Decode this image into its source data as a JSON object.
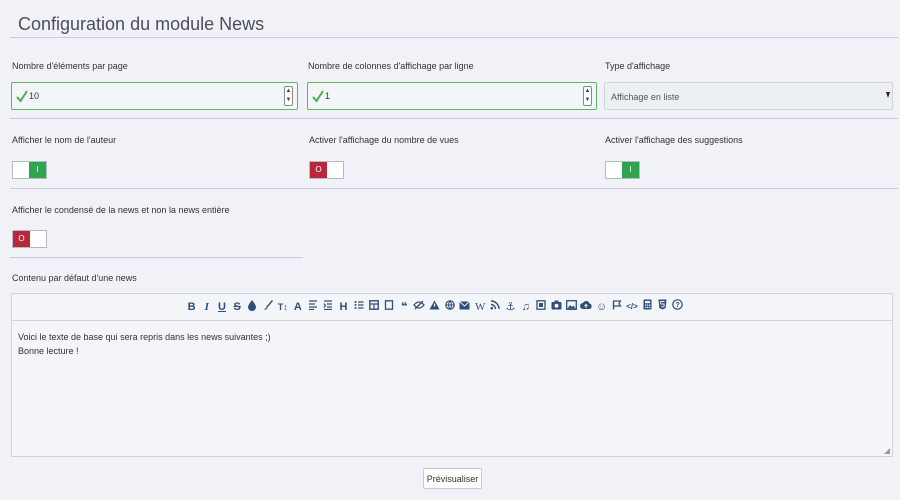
{
  "page": {
    "title": "Configuration du module News"
  },
  "items_per_page": {
    "label": "Nombre d'éléments par page",
    "value": "10"
  },
  "columns_per_row": {
    "label": "Nombre de colonnes d'affichage par ligne",
    "value": "1"
  },
  "display_type": {
    "label": "Type d'affichage",
    "value": "Affichage en liste"
  },
  "show_author": {
    "label": "Afficher le nom de l'auteur",
    "state": "I"
  },
  "show_views": {
    "label": "Activer l'affichage du nombre de vues",
    "state": "O"
  },
  "show_suggestions": {
    "label": "Activer l'affichage des suggestions",
    "state": "I"
  },
  "show_summary": {
    "label": "Afficher le condensé de la news et non la news entière",
    "state": "O"
  },
  "default_content": {
    "label": "Contenu par défaut d'une news",
    "line1": "Voici le texte de base qui sera repris dans les news suivantes ;)",
    "line2": "Bonne lecture !"
  },
  "toolbar": {
    "bold": "B",
    "italic": "I",
    "underline": "U",
    "strike": "S",
    "size": "T↕",
    "font": "A",
    "heading": "H",
    "quote": "❝",
    "wiki": "W",
    "anchor": "⚓",
    "music": "♫",
    "smiley": "☺",
    "code": "</>",
    "help": "?"
  },
  "preview_button": "Prévisualiser"
}
